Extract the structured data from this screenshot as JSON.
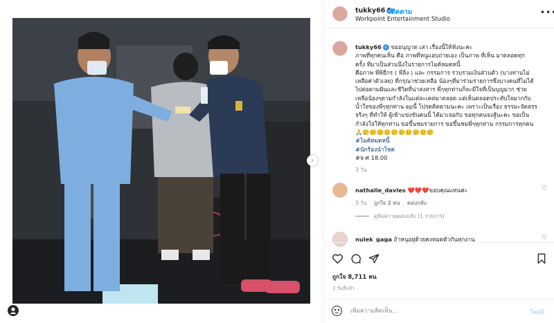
{
  "post": {
    "username": "tukky66",
    "follow_label": "ติดตาม",
    "location": "Workpoint Entertainment Studio",
    "caption_lines": [
      "ขออนุญาต เล่า เรื่องนี้ให้ฟังนะคะ",
      "ภาพที่ทุกคนเห็น คือ ภาพที่หนูแอบถ่ายเอง เป็นภาพ ที่เห็น มาตลอดทุก",
      "ครั้ง ที่มาเป็นส่วนนึงในรายการไมค์หมดหนี้",
      "คือภาพ พี่พิธีกร ( พี่ลิ่ง ) และ กรรมการ รวบรวมเงินส่วนตัว (บางท่านไม่",
      "เหลือค่าตัวเลย) ที่กรุณาช่วยเหลือ น้องๆที่มาร่วมรายการซึ่งบางคนที่ไม่ได้",
      "ไปต่อตามฝันและชีวิตที่น่าสงสาร พี่ๆทุกท่านก็จะมีใจที่เป็นบุญมาก ช่วย",
      "เหลือน้องๆตามกำลังในแต่ละเคสมาตลอด แต่เห็นตลอดประทับใจมากกับ",
      "น้ำใจของพี่ๆทุกท่าน epนี้ โปรดติดตามนะคะ เพราะเป็นเรื่อง ธรรมะจัดสรร",
      "จริงๆ ที่ทำให้ ผู้เข้าแข่งขันคนนี้ ได้มาเจอกับ ขอทุกคนจงสู้นะคะ ขอเป็น",
      "กำลังใจให้ทุกท่าน ขอขึ้นชมรายการ ขอขึ้นชมพี่ๆทุกท่าน กรรมการทุกคน",
      "🙏🥲🥲🥲🥲🥲🥲🥲🥲🥲🥲"
    ],
    "hashtags": [
      "#ไมค์หมดหนี้",
      "#นักร้องนำโชค",
      "#จ-ศ 18.00"
    ],
    "caption_age": "3 วัน"
  },
  "comments": [
    {
      "username": "nathalie_davies",
      "text": "❤️❤️❤️ขอบคุณแทนค่ะ",
      "age": "3 วัน",
      "likes": "ถูกใจ 2 คน",
      "reply": "ตอบกลับ",
      "view_replies": "ดูข้อความตอบกลับ (1 รายการ)"
    },
    {
      "username": "nulek_gaga",
      "text": "ถ้าหนูอยู่ด้วยคงหมดตัวกันทุกงาน"
    }
  ],
  "footer": {
    "likes": "ถูกใจ 8,711 คน",
    "time": "3 วันที่แล้ว",
    "comment_placeholder": "เพิ่มความคิดเห็น...",
    "post_label": "โพสต์"
  }
}
